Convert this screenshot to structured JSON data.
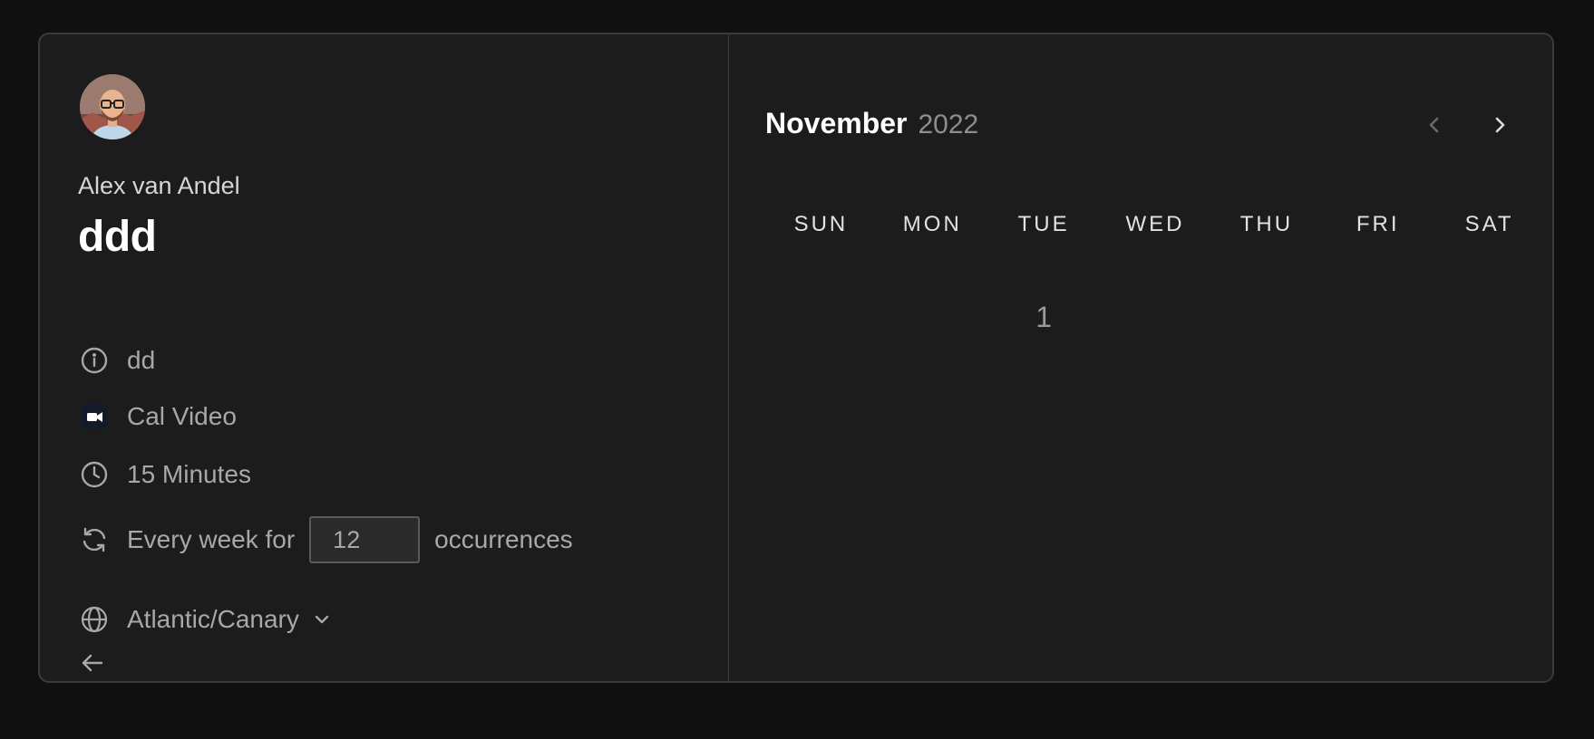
{
  "profile": {
    "name": "Alex van Andel"
  },
  "event": {
    "title": "ddd",
    "description": "dd",
    "location": "Cal Video",
    "duration": "15 Minutes",
    "recurrence": {
      "prefix": "Every week for",
      "count": "12",
      "suffix": "occurrences"
    },
    "timezone": "Atlantic/Canary"
  },
  "icons": {
    "description": "info-icon",
    "location": "video-icon",
    "duration": "clock-icon",
    "recurrence": "refresh-icon",
    "timezone": "globe-icon",
    "timezone_toggle": "chevron-down-icon",
    "back": "arrow-left-icon",
    "prev_month": "chevron-left-icon",
    "next_month": "chevron-right-icon"
  },
  "calendar": {
    "month": "November",
    "year": "2022",
    "weekdays": [
      "SUN",
      "MON",
      "TUE",
      "WED",
      "THU",
      "FRI",
      "SAT"
    ],
    "days": [
      "",
      "",
      "1",
      "",
      "",
      "",
      ""
    ]
  },
  "colors": {
    "background": "#101010",
    "card": "#1c1c1c",
    "border": "#3b3b3b",
    "text_primary": "#ffffff",
    "text_secondary": "#a8a8a8"
  }
}
